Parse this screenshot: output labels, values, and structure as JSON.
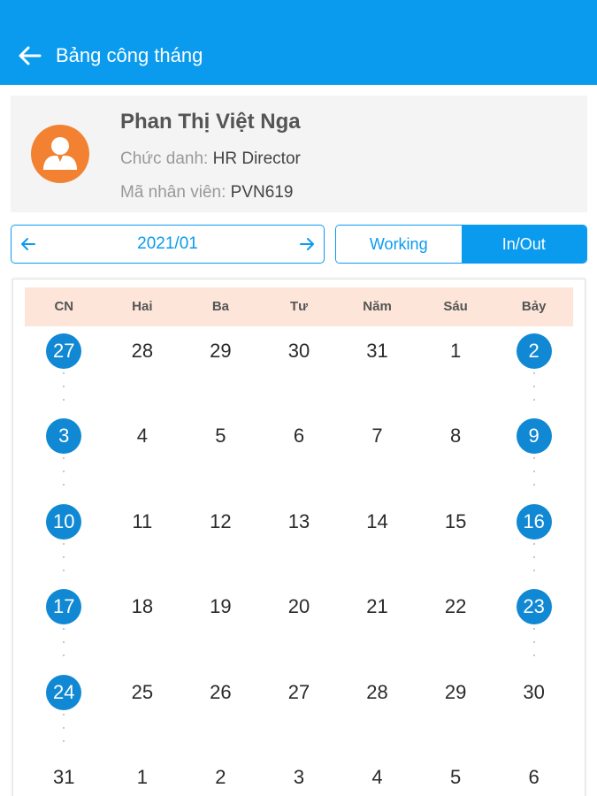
{
  "header": {
    "back_icon": "arrow-left-icon",
    "title": "Bảng công tháng"
  },
  "profile": {
    "avatar_icon": "user-avatar-icon",
    "name": "Phan Thị Việt Nga",
    "position_label": "Chức danh:",
    "position_value": "HR Director",
    "employee_id_label": "Mã nhân viên:",
    "employee_id_value": "PVN619"
  },
  "month_nav": {
    "prev_icon": "arrow-left-icon",
    "next_icon": "arrow-right-icon",
    "month": "2021/01"
  },
  "view_toggle": {
    "options": [
      "Working",
      "In/Out"
    ],
    "selected": "In/Out"
  },
  "colors": {
    "accent": "#0a9bef",
    "highlight_day": "#1088d3",
    "weekday_header_bg": "#fde6d9",
    "avatar_bg": "#f28231"
  },
  "calendar": {
    "weekdays": [
      "CN",
      "Hai",
      "Ba",
      "Tư",
      "Năm",
      "Sáu",
      "Bảy"
    ],
    "weeks": [
      [
        {
          "d": "27",
          "hl": true
        },
        {
          "d": "28"
        },
        {
          "d": "29"
        },
        {
          "d": "30"
        },
        {
          "d": "31"
        },
        {
          "d": "1"
        },
        {
          "d": "2",
          "hl": true
        }
      ],
      [
        {
          "d": "3",
          "hl": true
        },
        {
          "d": "4"
        },
        {
          "d": "5"
        },
        {
          "d": "6"
        },
        {
          "d": "7"
        },
        {
          "d": "8"
        },
        {
          "d": "9",
          "hl": true
        }
      ],
      [
        {
          "d": "10",
          "hl": true
        },
        {
          "d": "11"
        },
        {
          "d": "12"
        },
        {
          "d": "13"
        },
        {
          "d": "14"
        },
        {
          "d": "15"
        },
        {
          "d": "16",
          "hl": true
        }
      ],
      [
        {
          "d": "17",
          "hl": true
        },
        {
          "d": "18"
        },
        {
          "d": "19"
        },
        {
          "d": "20"
        },
        {
          "d": "21"
        },
        {
          "d": "22"
        },
        {
          "d": "23",
          "hl": true
        }
      ],
      [
        {
          "d": "24",
          "hl": true
        },
        {
          "d": "25"
        },
        {
          "d": "26"
        },
        {
          "d": "27"
        },
        {
          "d": "28"
        },
        {
          "d": "29"
        },
        {
          "d": "30"
        }
      ],
      [
        {
          "d": "31"
        },
        {
          "d": "1"
        },
        {
          "d": "2"
        },
        {
          "d": "3"
        },
        {
          "d": "4"
        },
        {
          "d": "5"
        },
        {
          "d": "6"
        }
      ]
    ]
  }
}
